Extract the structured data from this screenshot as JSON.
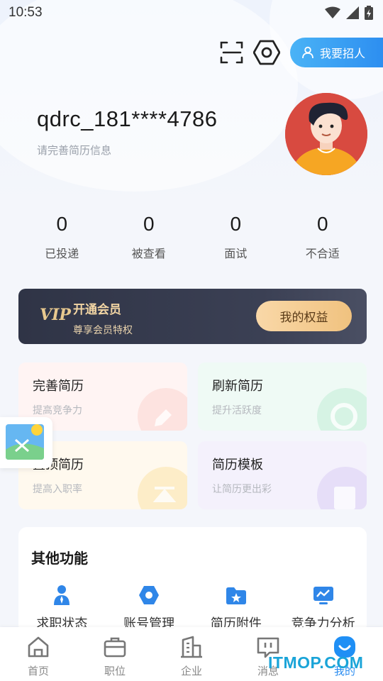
{
  "status_bar": {
    "time": "10:53"
  },
  "header": {
    "recruit_label": "我要招人"
  },
  "profile": {
    "username": "qdrc_181****4786",
    "hint": "请完善简历信息"
  },
  "stats": [
    {
      "value": "0",
      "label": "已投递"
    },
    {
      "value": "0",
      "label": "被查看"
    },
    {
      "value": "0",
      "label": "面试"
    },
    {
      "value": "0",
      "label": "不合适"
    }
  ],
  "vip": {
    "logo": "VIP",
    "title": "开通会员",
    "subtitle": "尊享会员特权",
    "button": "我的权益"
  },
  "cards": [
    {
      "title": "完善简历",
      "subtitle": "提高竞争力",
      "icon": "pencil-icon"
    },
    {
      "title": "刷新简历",
      "subtitle": "提升活跃度",
      "icon": "refresh-icon"
    },
    {
      "title": "置顶简历",
      "subtitle": "提高入职率",
      "icon": "pin-top-icon"
    },
    {
      "title": "简历模板",
      "subtitle": "让简历更出彩",
      "icon": "template-icon"
    }
  ],
  "other": {
    "title": "其他功能",
    "items": [
      {
        "label": "求职状态",
        "icon": "person-tie-icon"
      },
      {
        "label": "账号管理",
        "icon": "gear-icon"
      },
      {
        "label": "简历附件",
        "icon": "folder-star-icon"
      },
      {
        "label": "竞争力分析",
        "icon": "chart-monitor-icon"
      }
    ]
  },
  "tabs": [
    {
      "label": "首页",
      "icon": "home-icon"
    },
    {
      "label": "职位",
      "icon": "briefcase-icon"
    },
    {
      "label": "企业",
      "icon": "building-icon"
    },
    {
      "label": "消息",
      "icon": "message-icon"
    },
    {
      "label": "我的",
      "icon": "smile-icon"
    }
  ],
  "watermark": "ITMOP.COM",
  "colors": {
    "accent": "#2b8cf0",
    "vip_gold": "#f0c27f",
    "vip_dark": "#353a4d"
  }
}
